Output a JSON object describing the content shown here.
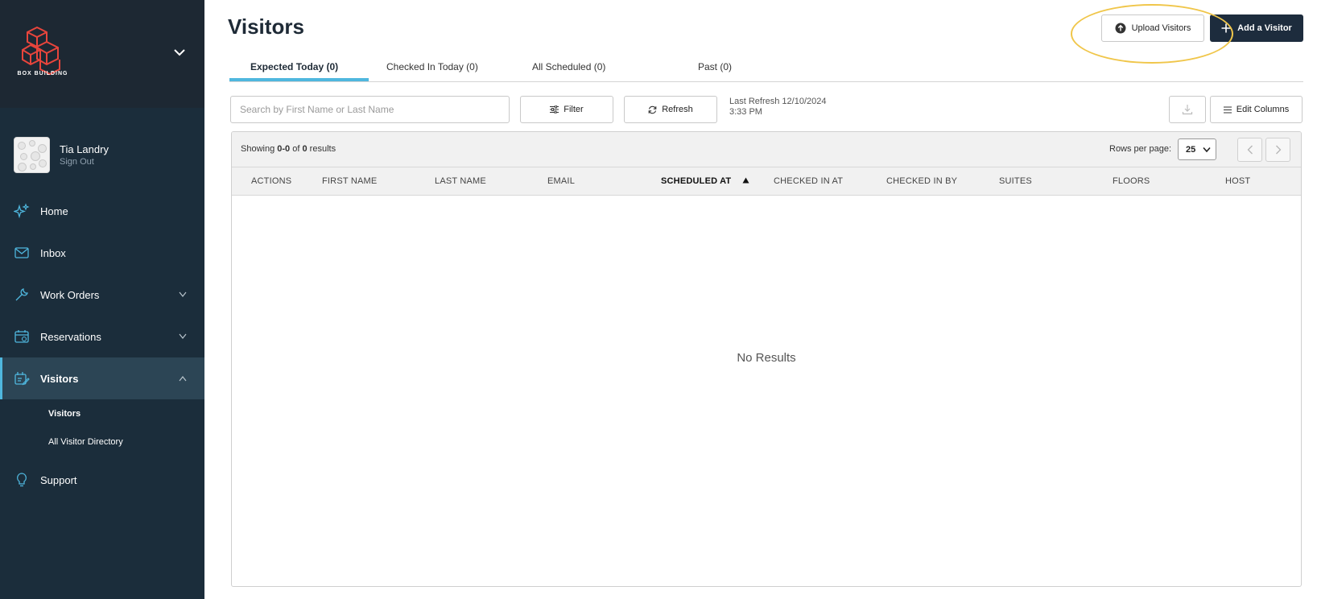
{
  "brand": {
    "logo_text": "BOX BUILDING",
    "accent_color": "#e8453c"
  },
  "user": {
    "name": "Tia Landry",
    "signout_label": "Sign Out"
  },
  "nav": {
    "items": [
      {
        "label": "Home",
        "icon": "sparkle-icon"
      },
      {
        "label": "Inbox",
        "icon": "envelope-icon"
      },
      {
        "label": "Work Orders",
        "icon": "wrench-icon"
      },
      {
        "label": "Reservations",
        "icon": "calendar-icon"
      },
      {
        "label": "Visitors",
        "icon": "visitor-edit-icon"
      },
      {
        "label": "Support",
        "icon": "lightbulb-icon"
      }
    ],
    "visitors_subitems": [
      "Visitors",
      "All Visitor Directory"
    ]
  },
  "page": {
    "title": "Visitors",
    "upload_label": "Upload Visitors",
    "add_label": "Add a Visitor"
  },
  "tabs": [
    {
      "label": "Expected Today (0)"
    },
    {
      "label": "Checked In Today (0)"
    },
    {
      "label": "All Scheduled (0)"
    },
    {
      "label": "Past (0)"
    }
  ],
  "toolbar": {
    "search_placeholder": "Search by First Name or Last Name",
    "filter_label": "Filter",
    "refresh_label": "Refresh",
    "last_refresh_line1": "Last Refresh 12/10/2024",
    "last_refresh_line2": "3:33 PM",
    "edit_columns_label": "Edit Columns"
  },
  "table": {
    "showing_prefix": "Showing",
    "range": "0-0",
    "of_label": "of",
    "total": "0",
    "results_label": "results",
    "rows_per_page_label": "Rows per page:",
    "rows_per_page_value": "25",
    "columns": [
      "ACTIONS",
      "FIRST NAME",
      "LAST NAME",
      "EMAIL",
      "SCHEDULED AT",
      "CHECKED IN AT",
      "CHECKED IN BY",
      "SUITES",
      "FLOORS",
      "HOST"
    ],
    "empty_message": "No Results"
  }
}
